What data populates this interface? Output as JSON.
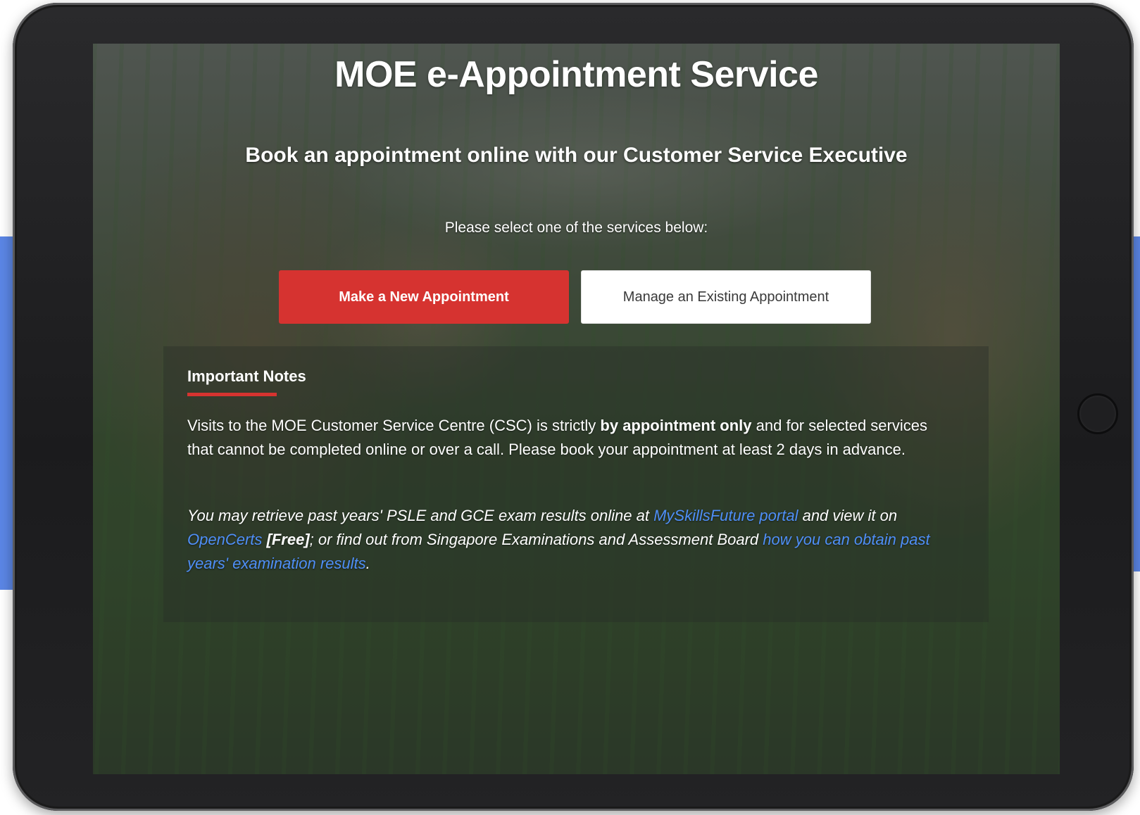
{
  "page": {
    "title": "MOE e-Appointment Service",
    "subtitle": "Book an appointment online with our Customer Service Executive",
    "select_prompt": "Please select one of the services below:"
  },
  "buttons": {
    "new_appointment": "Make a New Appointment",
    "manage_appointment": "Manage an Existing Appointment"
  },
  "notes": {
    "heading": "Important Notes",
    "para1": {
      "before": "Visits to the MOE Customer Service Centre (CSC) is strictly ",
      "bold": "by appointment only",
      "after": " and for selected services that cannot be completed online or over a call. Please book your appointment at least 2 days in advance."
    },
    "para2": {
      "text1": "You may retrieve past years' PSLE and GCE exam results online at ",
      "link1": "MySkillsFuture portal",
      "text2": " and view it on ",
      "link2": "OpenCerts",
      "text3": " ",
      "bold": "[Free]",
      "text4": "; or find out from Singapore Examinations and Assessment Board ",
      "link3": "how you can obtain past years' examination results",
      "text5": "."
    }
  },
  "colors": {
    "accent_red": "#d63330",
    "link_blue": "#4f8ff7",
    "side_band_blue": "#5b86e5"
  }
}
